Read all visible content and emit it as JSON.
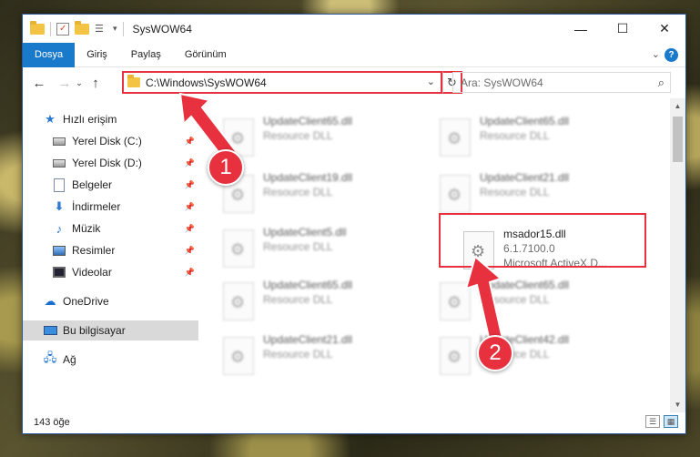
{
  "window": {
    "title": "SysWOW64",
    "controls": {
      "minimize": "—",
      "maximize": "☐",
      "close": "✕"
    }
  },
  "ribbon": {
    "tabs": [
      "Dosya",
      "Giriş",
      "Paylaş",
      "Görünüm"
    ],
    "help": "?"
  },
  "address": {
    "path": "C:\\Windows\\SysWOW64",
    "search_placeholder": "Ara: SysWOW64"
  },
  "nav": {
    "quick_access": "Hızlı erişim",
    "items": [
      {
        "label": "Yerel Disk (C:)",
        "icon": "drive-icon"
      },
      {
        "label": "Yerel Disk (D:)",
        "icon": "drive-icon"
      },
      {
        "label": "Belgeler",
        "icon": "documents-icon"
      },
      {
        "label": "İndirmeler",
        "icon": "downloads-icon"
      },
      {
        "label": "Müzik",
        "icon": "music-icon"
      },
      {
        "label": "Resimler",
        "icon": "pictures-icon"
      },
      {
        "label": "Videolar",
        "icon": "videos-icon"
      }
    ],
    "onedrive": "OneDrive",
    "this_pc": "Bu bilgisayar",
    "network": "Ağ"
  },
  "files": {
    "left": [
      {
        "name": "UpdateClient65.dll",
        "type": "Resource DLL"
      },
      {
        "name": "UpdateClient19.dll",
        "type": "Resource DLL"
      },
      {
        "name": "UpdateClient5.dll",
        "type": "Resource DLL"
      },
      {
        "name": "UpdateClient65.dll",
        "type": "Resource DLL"
      },
      {
        "name": "UpdateClient21.dll",
        "type": "Resource DLL"
      }
    ],
    "right": [
      {
        "name": "UpdateClient65.dll",
        "type": "Resource DLL"
      },
      {
        "name": "UpdateClient21.dll",
        "type": "Resource DLL"
      },
      {
        "name": "UpdateClient65.dll",
        "type": "Resource DLL"
      },
      {
        "name": "UpdateClient42.dll",
        "type": "Resource DLL"
      }
    ],
    "highlighted": {
      "name": "msador15.dll",
      "version": "6.1.7100.0",
      "description": "Microsoft ActiveX D..."
    }
  },
  "status": {
    "count": "143 öğe"
  },
  "annotations": {
    "step1": "1",
    "step2": "2",
    "color": "#e8313e"
  }
}
